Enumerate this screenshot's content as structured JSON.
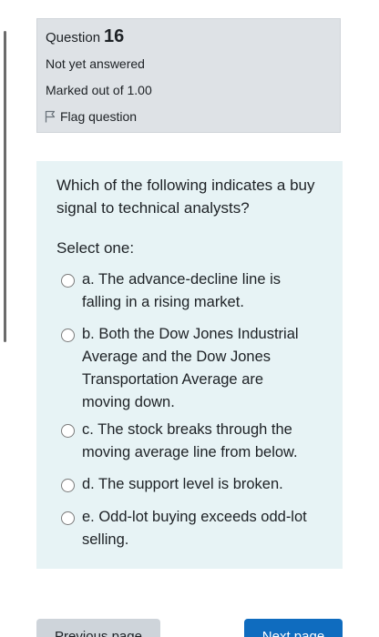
{
  "question_info": {
    "label": "Question",
    "number": "16",
    "status": "Not yet answered",
    "marks": "Marked out of 1.00",
    "flag_label": "Flag question"
  },
  "question": {
    "text": "Which of the following indicates a buy signal to technical analysts?",
    "prompt": "Select one:",
    "options": [
      {
        "label": "a. The advance-decline line is falling in a rising market."
      },
      {
        "label": "b. Both the Dow Jones Industrial Average and the Dow Jones Transportation Average are moving down."
      },
      {
        "label": "c. The stock breaks through the moving average line from below."
      },
      {
        "label": "d. The support level is broken."
      },
      {
        "label": "e. Odd-lot buying exceeds odd-lot selling."
      }
    ]
  },
  "navigation": {
    "previous_label": "Previous page",
    "next_label": "Next page"
  },
  "colors": {
    "info_background": "#dee2e6",
    "question_background": "#e7f3f5",
    "next_button": "#0f6cbf",
    "previous_button": "#ced4da"
  }
}
